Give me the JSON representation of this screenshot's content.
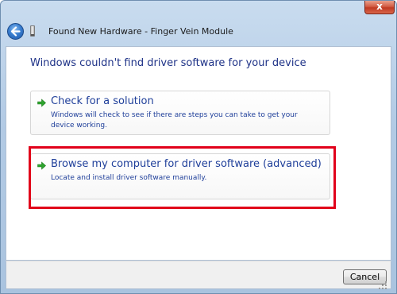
{
  "window": {
    "title": "Found New Hardware - Finger Vein Module",
    "close_glyph": "x"
  },
  "content": {
    "heading": "Windows couldn't find driver software for your device",
    "options": [
      {
        "title": "Check for a solution",
        "description": "Windows will check to see if there are steps you can take to get your device working.",
        "icon": "green-arrow-icon"
      },
      {
        "title": "Browse my computer for driver software (advanced)",
        "description": "Locate and install driver software manually.",
        "icon": "green-arrow-icon",
        "highlighted": true
      }
    ]
  },
  "footer": {
    "cancel_label": "Cancel"
  },
  "colors": {
    "heading": "#1e3287",
    "link": "#1f3f9a",
    "highlight_border": "#e1001a",
    "arrow": "#2fa52f"
  }
}
